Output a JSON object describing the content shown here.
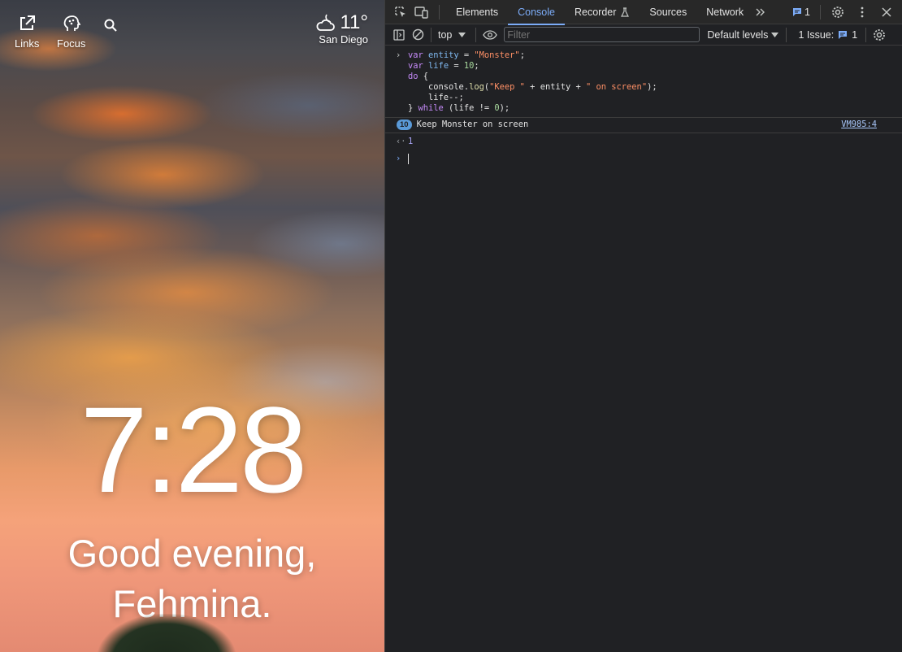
{
  "ntp": {
    "links_label": "Links",
    "focus_label": "Focus",
    "weather_temp": "11°",
    "weather_city": "San Diego",
    "clock": "7:28",
    "greeting_line1": "Good evening,",
    "greeting_line2": "Fehmina."
  },
  "devtools": {
    "tabs": [
      "Elements",
      "Console",
      "Recorder",
      "Sources",
      "Network"
    ],
    "active_tab": "Console",
    "message_count": "1",
    "context": "top",
    "filter_placeholder": "Filter",
    "levels": "Default levels",
    "issues_label": "1 Issue:",
    "issues_count": "1"
  },
  "console": {
    "code": [
      "var entity = \"Monster\";",
      "var life = 10;",
      "do {",
      "    console.log(\"Keep \" + entity + \" on screen\");",
      "    life--;",
      "} while (life != 0);"
    ],
    "log_count": "10",
    "log_message": "Keep Monster on screen",
    "log_source": "VM985:4",
    "result_value": "1"
  },
  "colors": {
    "accent": "#7cacf8",
    "panel_bg": "#202124"
  }
}
